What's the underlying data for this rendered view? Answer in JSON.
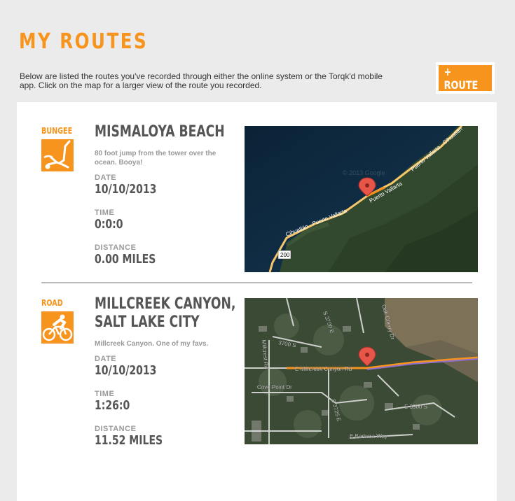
{
  "header": {
    "title": "MY ROUTES",
    "intro": "Below are listed the routes you've recorded through either the online system or the Torqk'd mobile app. Click on the map for a larger view of the route you recorded.",
    "add_route_label": "+ ROUTE"
  },
  "routes": [
    {
      "type": "BUNGEE",
      "icon": "bungee-icon",
      "title_line1": "MISMALOYA BEACH",
      "title_line2": "",
      "description": "80 foot jump from the tower over the ocean. Booya!",
      "date_label": "DATE",
      "date": "10/10/2013",
      "time_label": "TIME",
      "time": "0:0:0",
      "distance_label": "DISTANCE",
      "distance": "0.00 MILES",
      "map": {
        "labels": [
          "Puerto Vallarta - Cihuatlán",
          "Puerto Vallarta",
          "Cihuatlán - Puerto Vallarta",
          "200",
          "© 2013 Google"
        ]
      }
    },
    {
      "type": "ROAD",
      "icon": "road-bike-icon",
      "title_line1": "MILLCREEK CANYON,",
      "title_line2": "SALT LAKE CITY",
      "description": "Millcreek Canyon. One of my favs.",
      "date_label": "DATE",
      "date": "10/10/2013",
      "time_label": "TIME",
      "time": "1:26:0",
      "distance_label": "DISTANCE",
      "distance": "11.52 MILES",
      "map": {
        "labels": [
          "E Millcreek Canyon Rd",
          "3700 S",
          "Cove Point Dr",
          "S 3725 E",
          "E 3900 S",
          "E Barbara Way",
          "Millcrest Rd",
          "Oak Cherry Dr",
          "S 3700 E"
        ]
      }
    }
  ],
  "colors": {
    "accent": "#f7941d",
    "background": "#ebebeb",
    "text_dark": "#555555",
    "text_muted": "#999999"
  }
}
